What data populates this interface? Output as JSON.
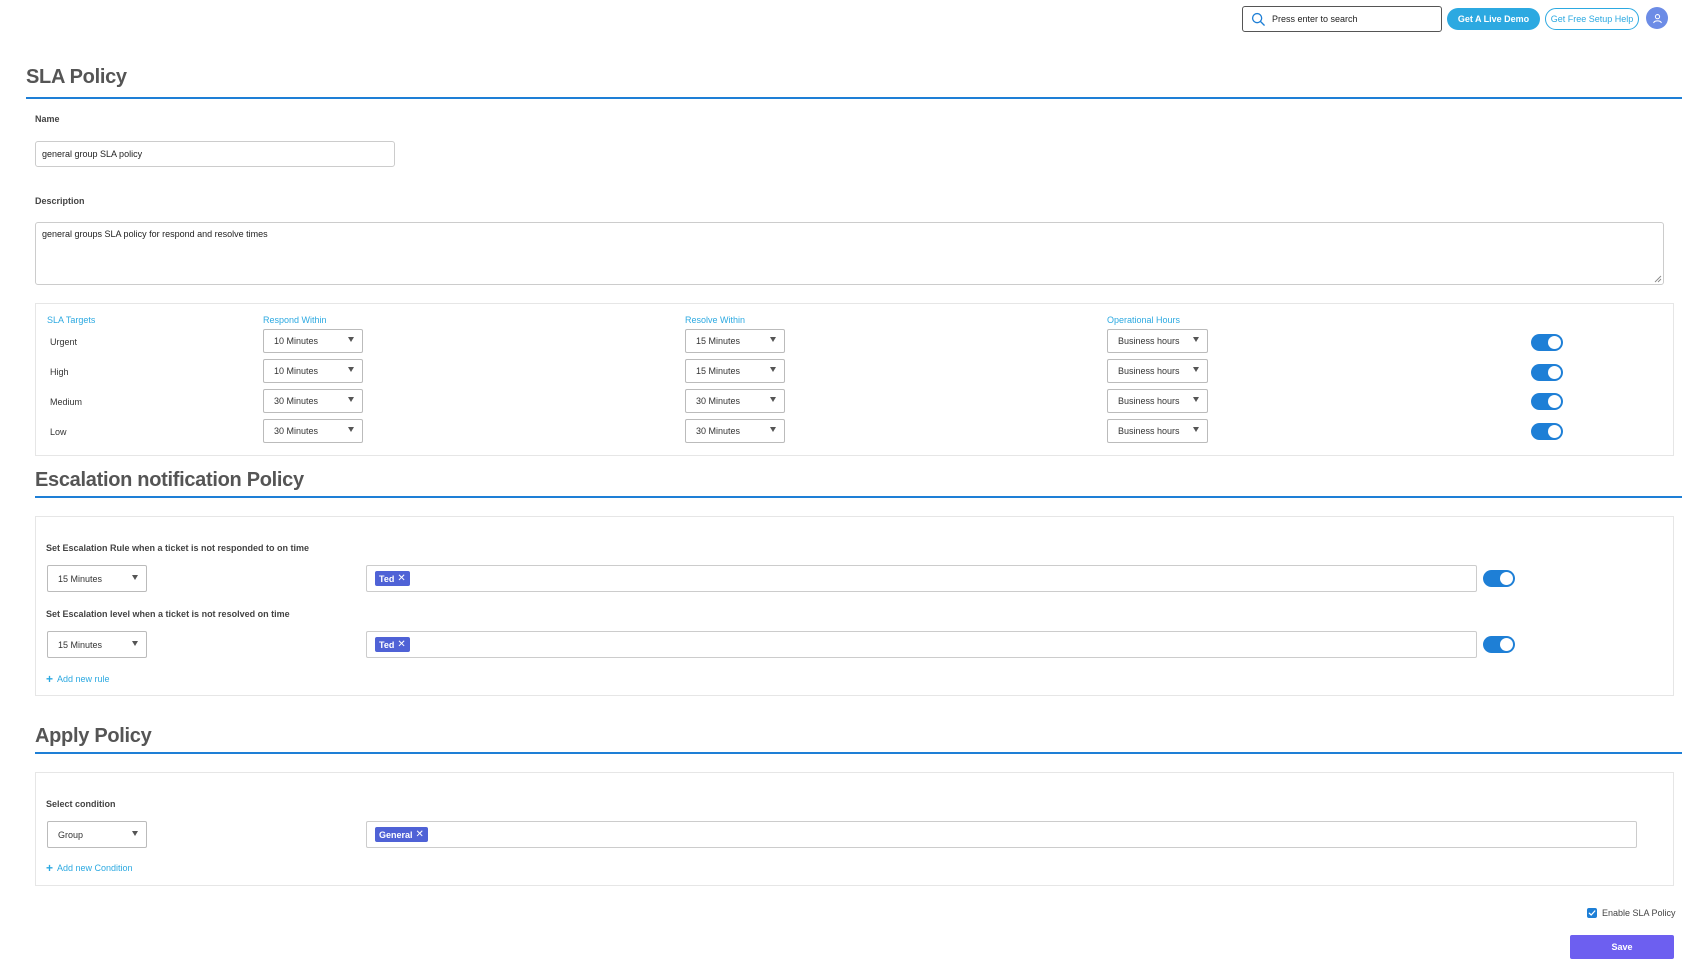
{
  "topbar": {
    "search_placeholder": "Press enter to search",
    "demo_label": "Get A Live Demo",
    "help_label": "Get Free Setup Help"
  },
  "sla": {
    "title": "SLA Policy",
    "name_label": "Name",
    "name_value": "general group SLA policy",
    "description_label": "Description",
    "description_value": "general groups SLA policy for respond and resolve times",
    "columns": {
      "targets": "SLA Targets",
      "respond": "Respond Within",
      "resolve": "Resolve Within",
      "hours": "Operational Hours"
    },
    "rows": [
      {
        "label": "Urgent",
        "respond": "10 Minutes",
        "resolve": "15 Minutes",
        "hours": "Business hours",
        "enabled": true
      },
      {
        "label": "High",
        "respond": "10 Minutes",
        "resolve": "15 Minutes",
        "hours": "Business hours",
        "enabled": true
      },
      {
        "label": "Medium",
        "respond": "30 Minutes",
        "resolve": "30 Minutes",
        "hours": "Business hours",
        "enabled": true
      },
      {
        "label": "Low",
        "respond": "30 Minutes",
        "resolve": "30 Minutes",
        "hours": "Business hours",
        "enabled": true
      }
    ]
  },
  "escalation": {
    "title": "Escalation notification Policy",
    "rules": [
      {
        "label": "Set Escalation Rule when a ticket is not responded to on time",
        "time": "15 Minutes",
        "tag": "Ted",
        "enabled": true
      },
      {
        "label": "Set Escalation level when a ticket is not resolved on time",
        "time": "15 Minutes",
        "tag": "Ted",
        "enabled": true
      }
    ],
    "add_label": "Add new rule"
  },
  "apply": {
    "title": "Apply Policy",
    "condition_label": "Select condition",
    "condition_value": "Group",
    "tag": "General",
    "add_label": "Add new Condition"
  },
  "footer": {
    "enable_label": "Enable SLA Policy",
    "enable_checked": true,
    "save_label": "Save"
  },
  "colors": {
    "accent": "#1e7fd6",
    "link": "#2ca9e1",
    "tag": "#4f62d6",
    "save": "#6d5ff0"
  }
}
